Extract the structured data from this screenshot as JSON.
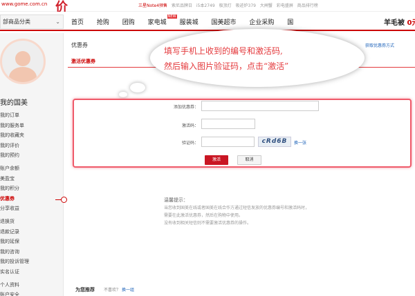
{
  "header": {
    "site_url": "www.gome.com.cn",
    "logo_glyph": "价",
    "promos": [
      "三星Note4预售",
      "索尼品牌日",
      "i5本2749",
      "极顶灯",
      "吸迹炉379",
      "大闸蟹",
      "彩电盛屏",
      "商品排行榜"
    ]
  },
  "nav": {
    "category_label": "部商品分类",
    "items": [
      "首页",
      "抢购",
      "团购",
      "家电城",
      "服装城",
      "国美超市",
      "企业采购",
      "国"
    ],
    "new_tag": "NEW",
    "user_name_prefix": "羊毛被",
    "user_name_suffix": "0元"
  },
  "sidebar": {
    "title": "我的国美",
    "menu": [
      "我的订单",
      "我的服务单",
      "我的收藏夹",
      "我的评价",
      "我的预约",
      "账户余额",
      "美盈宝",
      "我的积分",
      "优惠券",
      "分享收益",
      "退换货",
      "退款记录",
      "我的延保",
      "我的咨询",
      "我的投诉管理",
      "实名认证",
      "个人资料",
      "账户安全"
    ],
    "active_index": 8
  },
  "content": {
    "section_title": "优惠券",
    "section_link": "获取优惠券方式",
    "subtab": "激活优惠券"
  },
  "bubble": {
    "line1": "填写手机上收到的编号和激活码,",
    "line2": "然后输入图片验证码，点击“激活”"
  },
  "form": {
    "coupon_label": "添加优惠券：",
    "coupon_value": "",
    "code_label": "激活码：",
    "code_value": "",
    "captcha_label": "验证码：",
    "captcha_value": "",
    "captcha_text": "cRd6B",
    "refresh_label": "换一张",
    "activate_label": "激活",
    "cancel_label": "取消"
  },
  "tips": {
    "title": "温馨提示：",
    "lines": [
      "当您收到国美在线或者国美在线合作方通过短信发放的优惠券编号和激活码时，",
      "需要在此激活优惠券，然后在购物中使用。",
      "没有收到相关短信则不需要激活优惠券的操作。"
    ]
  },
  "recommend": {
    "title": "为您推荐",
    "question": "不喜欢？",
    "link": "换一组"
  },
  "colors": {
    "brand_red": "#c91623",
    "link_blue": "#1a60b8",
    "highlight_border": "#ef5a6a"
  }
}
